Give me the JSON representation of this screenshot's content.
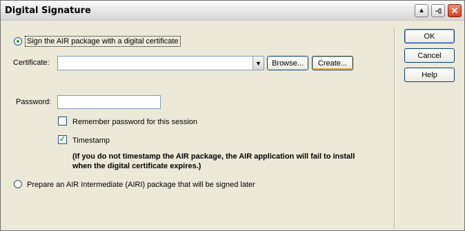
{
  "window": {
    "title": "Digital Signature"
  },
  "options": {
    "sign_label": "Sign the AIR package with a digital certificate",
    "prepare_label": "Prepare an AIR Intermediate (AIRI) package that will be signed later"
  },
  "certificate": {
    "label": "Certificate:",
    "value": "",
    "browse_label": "Browse...",
    "create_label": "Create..."
  },
  "password": {
    "label": "Password:",
    "value": ""
  },
  "remember": {
    "label": "Remember password for this session",
    "checked": false
  },
  "timestamp": {
    "label": "Timestamp",
    "checked": true,
    "note": "(If you do not timestamp the AIR package, the AIR application will fail to install when the digital certificate expires.)"
  },
  "buttons": {
    "ok": "OK",
    "cancel": "Cancel",
    "help": "Help"
  },
  "icons": {
    "collapse": "triangle-up-icon",
    "pin": "pin-icon",
    "close": "close-icon"
  }
}
